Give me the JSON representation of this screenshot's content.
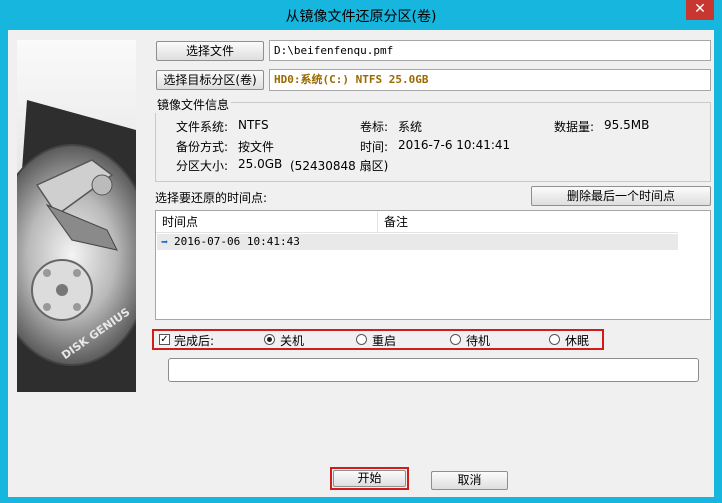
{
  "window": {
    "title": "从镜像文件还原分区(卷)",
    "close_icon": "close-icon"
  },
  "image_file": {
    "button": "选择文件",
    "value": "D:\\beifenfenqu.pmf"
  },
  "target": {
    "button": "选择目标分区(卷)",
    "value": "HD0:系统(C:) NTFS 25.0GB",
    "value_color": "#9a6a00"
  },
  "info": {
    "title": "镜像文件信息",
    "fs_label": "文件系统:",
    "fs_value": "NTFS",
    "vol_label": "卷标:",
    "vol_value": "系统",
    "data_label": "数据量:",
    "data_value": "95.5MB",
    "method_label": "备份方式:",
    "method_value": "按文件",
    "time_label": "时间:",
    "time_value": "2016-7-6 10:41:41",
    "size_label": "分区大小:",
    "size_value": "25.0GB",
    "sectors_value": "(52430848 扇区)"
  },
  "timepoints": {
    "label": "选择要还原的时间点:",
    "delete_button": "删除最后一个时间点",
    "headers": [
      "时间点",
      "备注"
    ],
    "rows": [
      {
        "time": "2016-07-06 10:41:43",
        "note": ""
      }
    ]
  },
  "after": {
    "label": "完成后:",
    "checked": true,
    "options": [
      "关机",
      "重启",
      "待机",
      "休眠"
    ],
    "selected_index": 0
  },
  "progress": {
    "value": 0
  },
  "buttons": {
    "start": "开始",
    "cancel": "取消"
  },
  "colors": {
    "title_bg": "#17b6df",
    "close_bg": "#c7372f",
    "highlight": "#d21c1c"
  }
}
